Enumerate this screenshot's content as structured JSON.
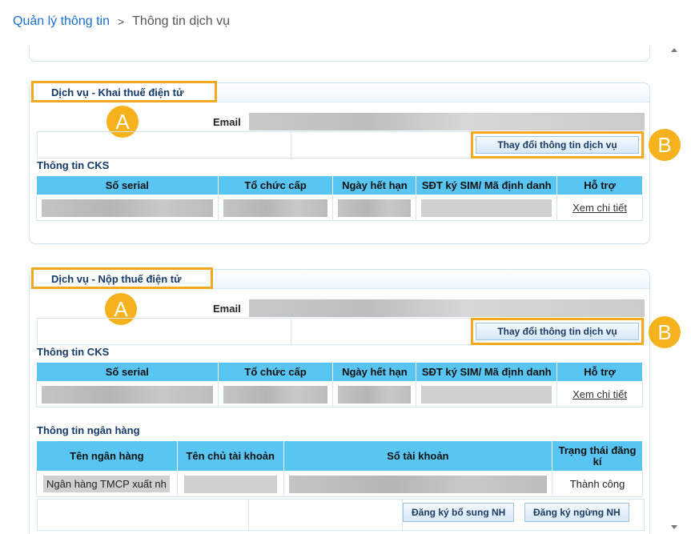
{
  "breadcrumb": {
    "parent": "Quản lý thông tin",
    "separator": ">",
    "current": "Thông tin dịch vụ"
  },
  "sections": [
    {
      "title": "Dịch vụ - Khai thuế điện tử",
      "badge_a": "A",
      "email_label": "Email",
      "change_button": "Thay đổi thông tin dịch vụ",
      "badge_b": "B",
      "cks_title": "Thông tin CKS",
      "cks_headers": [
        "Số serial",
        "Tổ chức cấp",
        "Ngày hết hạn",
        "SĐT ký SIM/ Mã định danh",
        "Hỗ trợ"
      ],
      "support_link": "Xem chi tiết"
    },
    {
      "title": "Dịch vụ - Nộp thuế điện tử",
      "badge_a": "A",
      "email_label": "Email",
      "change_button": "Thay đổi thông tin dịch vụ",
      "badge_b": "B",
      "cks_title": "Thông tin CKS",
      "cks_headers": [
        "Số serial",
        "Tổ chức cấp",
        "Ngày hết hạn",
        "SĐT ký SIM/ Mã định danh",
        "Hỗ trợ"
      ],
      "support_link": "Xem chi tiết",
      "bank_title": "Thông tin ngân hàng",
      "bank_headers": [
        "Tên ngân hàng",
        "Tên chủ tài khoản",
        "Số tài khoản",
        "Trạng thái đăng kí"
      ],
      "bank_row": {
        "bank_name": "Ngân hàng TMCP xuất nh",
        "status": "Thành công"
      },
      "add_bank_button": "Đăng ký bổ sung NH",
      "stop_bank_button": "Đăng ký ngừng NH"
    }
  ],
  "colors": {
    "highlight": "#f4a81b",
    "badge": "#f6b21d",
    "table_header": "#59c5f3",
    "link": "#1a6fd1"
  }
}
